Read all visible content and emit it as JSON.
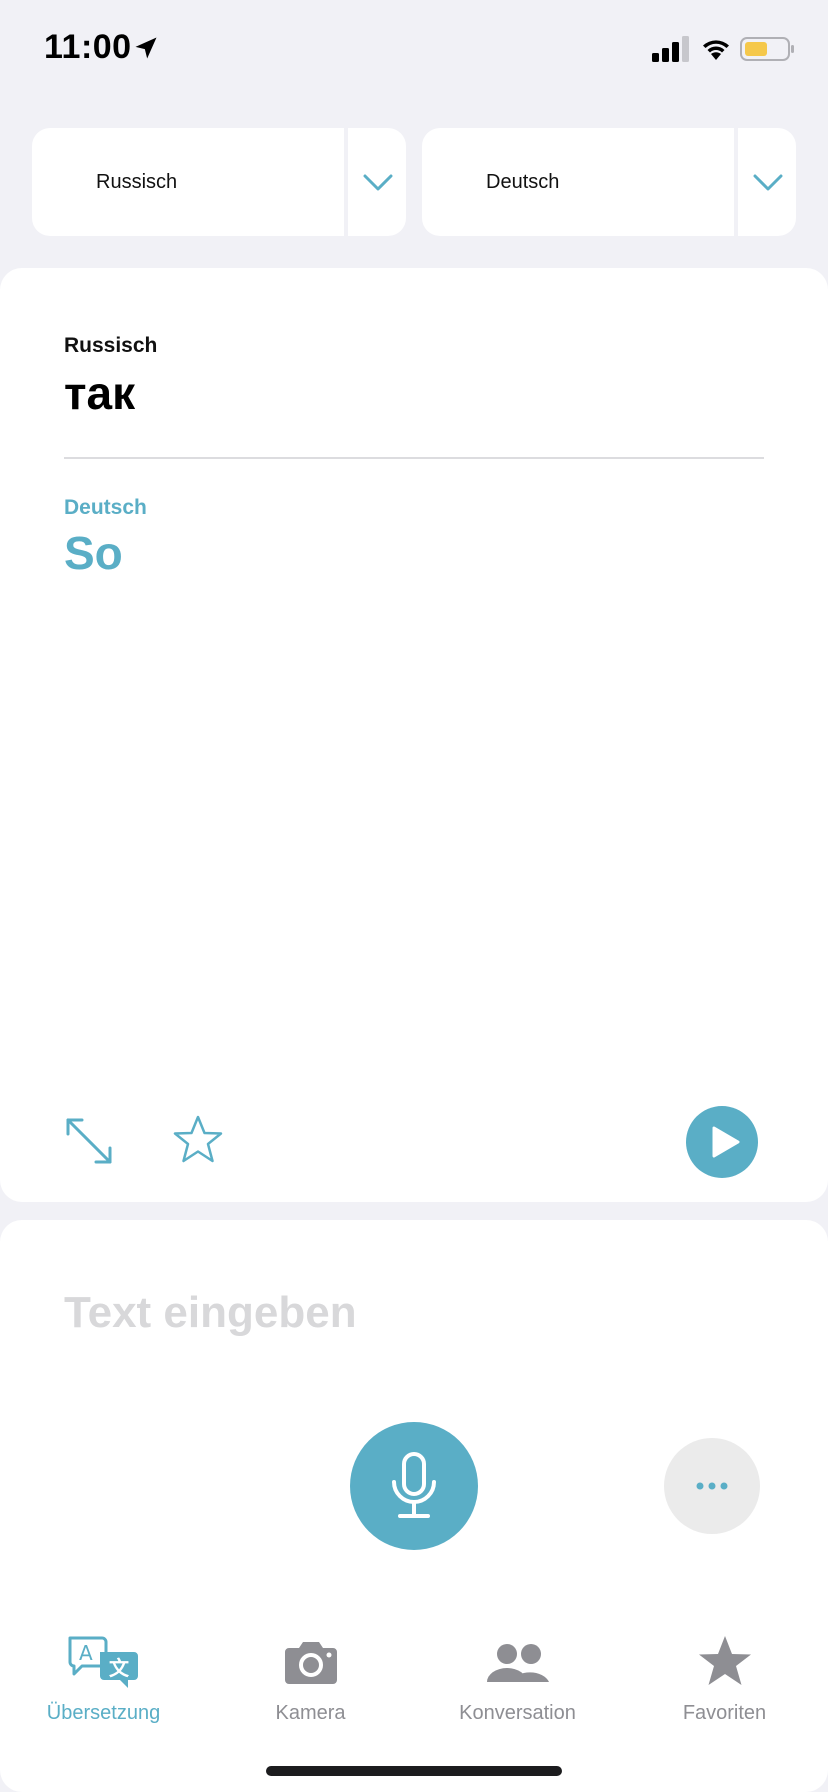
{
  "status_bar": {
    "time": "11:00",
    "icons": [
      "location-arrow-icon",
      "cellular-signal-icon",
      "wifi-icon",
      "battery-icon"
    ],
    "battery_color": "#f5c84b"
  },
  "languages": {
    "source": "Russisch",
    "target": "Deutsch"
  },
  "translation": {
    "source_label": "Russisch",
    "source_text": "так",
    "target_label": "Deutsch",
    "target_text": "So"
  },
  "input": {
    "placeholder": "Text eingeben"
  },
  "tabs": [
    {
      "label": "Übersetzung",
      "icon": "translate-icon",
      "active": true
    },
    {
      "label": "Kamera",
      "icon": "camera-icon",
      "active": false
    },
    {
      "label": "Konversation",
      "icon": "people-icon",
      "active": false
    },
    {
      "label": "Favoriten",
      "icon": "star-icon",
      "active": false
    }
  ],
  "colors": {
    "accent": "#5aaec6",
    "background": "#f1f1f6",
    "card": "#ffffff",
    "inactive": "#8e8e93"
  }
}
